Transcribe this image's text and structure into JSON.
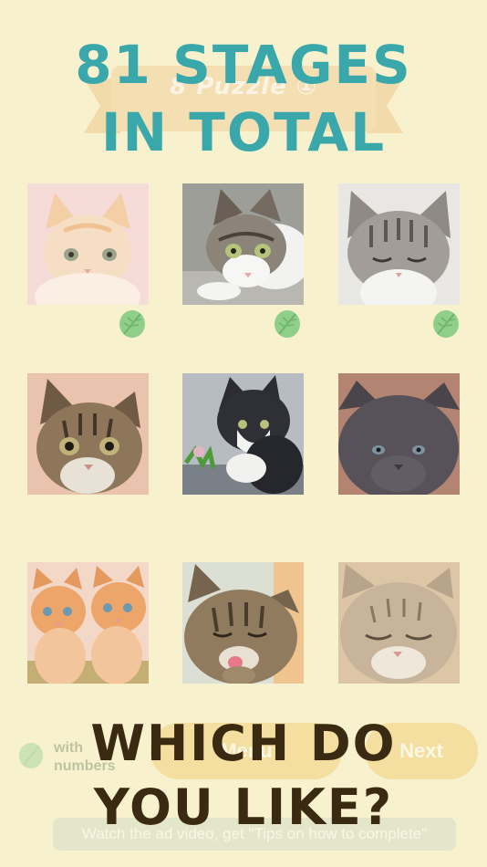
{
  "header": {
    "line1": "81 STAGES",
    "line2": "IN TOTAL",
    "background_title": "8 Puzzle ①"
  },
  "footer": {
    "line1": "WHICH DO",
    "line2": "YOU LIKE?"
  },
  "faded_controls": {
    "numbers_toggle_label_line1": "with",
    "numbers_toggle_label_line2": "numbers",
    "menu_button_label": "Menu",
    "next_button_label": "Next",
    "tips_button_label": "Watch the ad video, get \"Tips on how to complete\""
  },
  "colors": {
    "background": "#f7f1cd",
    "headline_top": "#3aa8ab",
    "headline_bottom": "#3b2a12",
    "leaf": "#8fcf8a",
    "button": "#f1c96b"
  },
  "stages": [
    {
      "index": 1,
      "subject": "cream kitten",
      "cleared": true
    },
    {
      "index": 2,
      "subject": "tabby and white kitten lying down",
      "cleared": true
    },
    {
      "index": 3,
      "subject": "grey tabby kitten eyes closed",
      "cleared": true
    },
    {
      "index": 4,
      "subject": "brown tabby kitten",
      "cleared": false
    },
    {
      "index": 5,
      "subject": "black and white kitten playing",
      "cleared": false
    },
    {
      "index": 6,
      "subject": "dark grey kitten",
      "cleared": false
    },
    {
      "index": 7,
      "subject": "two orange kittens",
      "cleared": false
    },
    {
      "index": 8,
      "subject": "tabby kitten licking paw",
      "cleared": false
    },
    {
      "index": 9,
      "subject": "sleeping tabby kitten",
      "cleared": false
    }
  ]
}
